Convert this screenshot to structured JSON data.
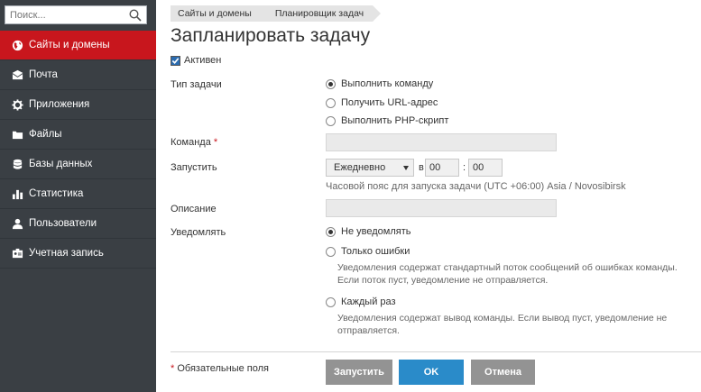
{
  "sidebar": {
    "search_placeholder": "Поиск...",
    "items": [
      {
        "label": "Сайты и домены",
        "icon": "globe-icon",
        "active": true
      },
      {
        "label": "Почта",
        "icon": "mail-icon"
      },
      {
        "label": "Приложения",
        "icon": "gear-icon"
      },
      {
        "label": "Файлы",
        "icon": "folder-icon"
      },
      {
        "label": "Базы данных",
        "icon": "database-icon"
      },
      {
        "label": "Статистика",
        "icon": "bar-chart-icon"
      },
      {
        "label": "Пользователи",
        "icon": "user-icon"
      },
      {
        "label": "Учетная запись",
        "icon": "id-card-icon"
      }
    ]
  },
  "breadcrumb": [
    "Сайты и домены",
    "Планировщик задач"
  ],
  "page_title": "Запланировать задачу",
  "active_label": "Активен",
  "task_type": {
    "label": "Тип задачи",
    "options": [
      "Выполнить команду",
      "Получить URL-адрес",
      "Выполнить PHP-скрипт"
    ],
    "selected": "Выполнить команду"
  },
  "command": {
    "label": "Команда",
    "required_mark": "*",
    "value": ""
  },
  "run": {
    "label": "Запустить",
    "frequency": "Ежедневно",
    "at_label": "в",
    "hour": "00",
    "minute": "00",
    "separator": ":",
    "timezone_note": "Часовой пояс для запуска задачи (UTC +06:00) Asia / Novosibirsk"
  },
  "description": {
    "label": "Описание",
    "value": ""
  },
  "notify": {
    "label": "Уведомлять",
    "options": [
      {
        "label": "Не уведомлять",
        "hint": ""
      },
      {
        "label": "Только ошибки",
        "hint_line1": "Уведомления содержат стандартный поток сообщений об ошибках команды.",
        "hint_line2": "Если поток пуст, уведомление не отправляется."
      },
      {
        "label": "Каждый раз",
        "hint_line1": "Уведомления содержат вывод команды. Если вывод пуст, уведомление не",
        "hint_line2": "отправляется."
      }
    ],
    "selected": "Не уведомлять"
  },
  "footer": {
    "required_note_mark": "*",
    "required_note": "Обязательные поля",
    "buttons": {
      "run": "Запустить",
      "ok": "OK",
      "cancel": "Отмена"
    }
  },
  "colors": {
    "active_nav": "#c8161d",
    "sidebar_bg": "#3a3f44",
    "ok_button": "#2a8bc9",
    "secondary_button": "#939393"
  }
}
